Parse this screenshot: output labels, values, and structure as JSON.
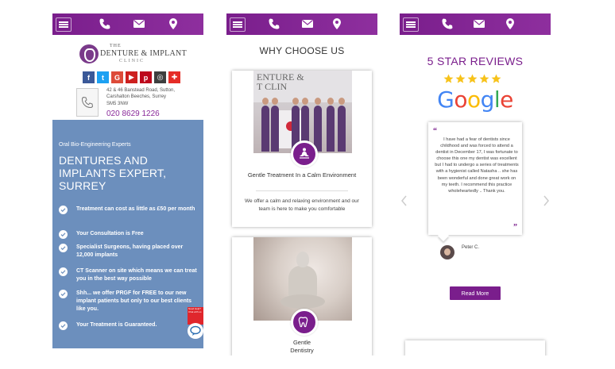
{
  "colors": {
    "brand": "#7a1e8c",
    "hero_blue": "#6c8fbd"
  },
  "topbar": {
    "icons": [
      "menu-icon",
      "phone-icon",
      "mail-icon",
      "location-pin-icon"
    ]
  },
  "screen1": {
    "logo": {
      "the": "THE",
      "name": "DENTURE & IMPLANT",
      "clinic": "CLINIC"
    },
    "socials": [
      {
        "name": "facebook",
        "glyph": "f",
        "color": "#3b5998"
      },
      {
        "name": "twitter",
        "glyph": "t",
        "color": "#1da1f2"
      },
      {
        "name": "google-plus",
        "glyph": "G",
        "color": "#dd4b39"
      },
      {
        "name": "youtube",
        "glyph": "▶",
        "color": "#cd201f"
      },
      {
        "name": "pinterest",
        "glyph": "p",
        "color": "#bd081c"
      },
      {
        "name": "instagram",
        "glyph": "◎",
        "color": "#3f3f3f"
      },
      {
        "name": "plus",
        "glyph": "✚",
        "color": "#e52d27"
      }
    ],
    "address": [
      "42 & 46 Banstead Road, Sutton,",
      "Carshalton Beeches, Surrey",
      "SM5 3NW"
    ],
    "phone": "020 8629 1226",
    "hero": {
      "kicker": "Oral Bio-Engineering Experts",
      "heading": "DENTURES AND IMPLANTS EXPERT, SURREY",
      "features": [
        "Treatment can cost as little as £50 per month",
        "Your Consultation is Free",
        "Specialist Surgeons, having placed over 12,000 implants",
        "CT Scanner on site which means we can treat you in the best way possible",
        "Shh... we offer PRGF for FREE to our new implant patients but only to our best clients like you.",
        "Your Treatment is Guaranteed."
      ]
    },
    "nhs_badge": "Need Help? Chat with us"
  },
  "screen2": {
    "title": "WHY CHOOSE US",
    "card1": {
      "sign": "ENTURE &\nT CLIN",
      "title": "Gentle Treatment In a Calm Environment",
      "text": "We offer a calm and relaxing environment and our team is here to make you comfortable"
    },
    "card2": {
      "title": "Gentle\nDentistry"
    }
  },
  "screen3": {
    "title": "5 STAR REVIEWS",
    "stars": 5,
    "google": [
      {
        "ch": "G",
        "color": "#4285f4"
      },
      {
        "ch": "o",
        "color": "#ea4335"
      },
      {
        "ch": "o",
        "color": "#fbbc05"
      },
      {
        "ch": "g",
        "color": "#4285f4"
      },
      {
        "ch": "l",
        "color": "#34a853"
      },
      {
        "ch": "e",
        "color": "#ea4335"
      }
    ],
    "open_quote": "“",
    "close_quote": "”",
    "quote": "I have had a fear of dentists since childhood and was forced to attend a dentist in December 17, I was fortunate to choose this one my dentist was excellent but I had to undergo a series of treatments with a hygienist called Natasha .. she has been wonderful and done great work on my teeth. I recommend this practice wholeheartedly .. Thank you.",
    "reviewer": "Peter C.",
    "read_more": "Read More"
  }
}
